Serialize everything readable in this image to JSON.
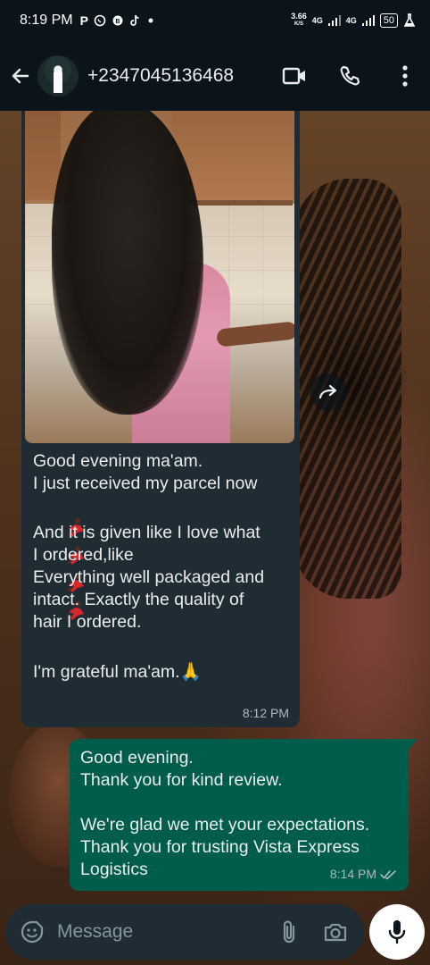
{
  "status_bar": {
    "time": "8:19 PM",
    "app_icons": [
      "P",
      "whatsapp-icon",
      "whatsapp-icon",
      "tiktok-icon",
      "dot"
    ],
    "net_speed_value": "3.66",
    "net_speed_unit": "K/S",
    "network_1": "4G",
    "network_2": "4G",
    "battery": "50"
  },
  "header": {
    "contact": "+2347045136468"
  },
  "incoming": {
    "lines": [
      "Good evening ma'am.",
      "I just received my parcel now",
      "",
      "And it is given like I love what",
      "I ordered,like",
      "Everything well packaged and",
      "intact. Exactly the quality of",
      "hair I ordered.",
      "",
      "I'm grateful ma'am."
    ],
    "dancer_emoji_count": 4,
    "pray_emoji": "🙏",
    "time": "8:12 PM"
  },
  "outgoing": {
    "lines": [
      "Good evening.",
      "Thank you for kind review.",
      "",
      "We're glad we met your expectations.",
      "Thank you for trusting Vista Express",
      "Logistics"
    ],
    "time": "8:14 PM",
    "status": "read"
  },
  "input": {
    "placeholder": "Message"
  },
  "colors": {
    "header_bg": "#0b141a",
    "incoming_bubble": "#1f2c34",
    "outgoing_bubble": "#005c4b",
    "read_ticks": "#aebac1"
  }
}
